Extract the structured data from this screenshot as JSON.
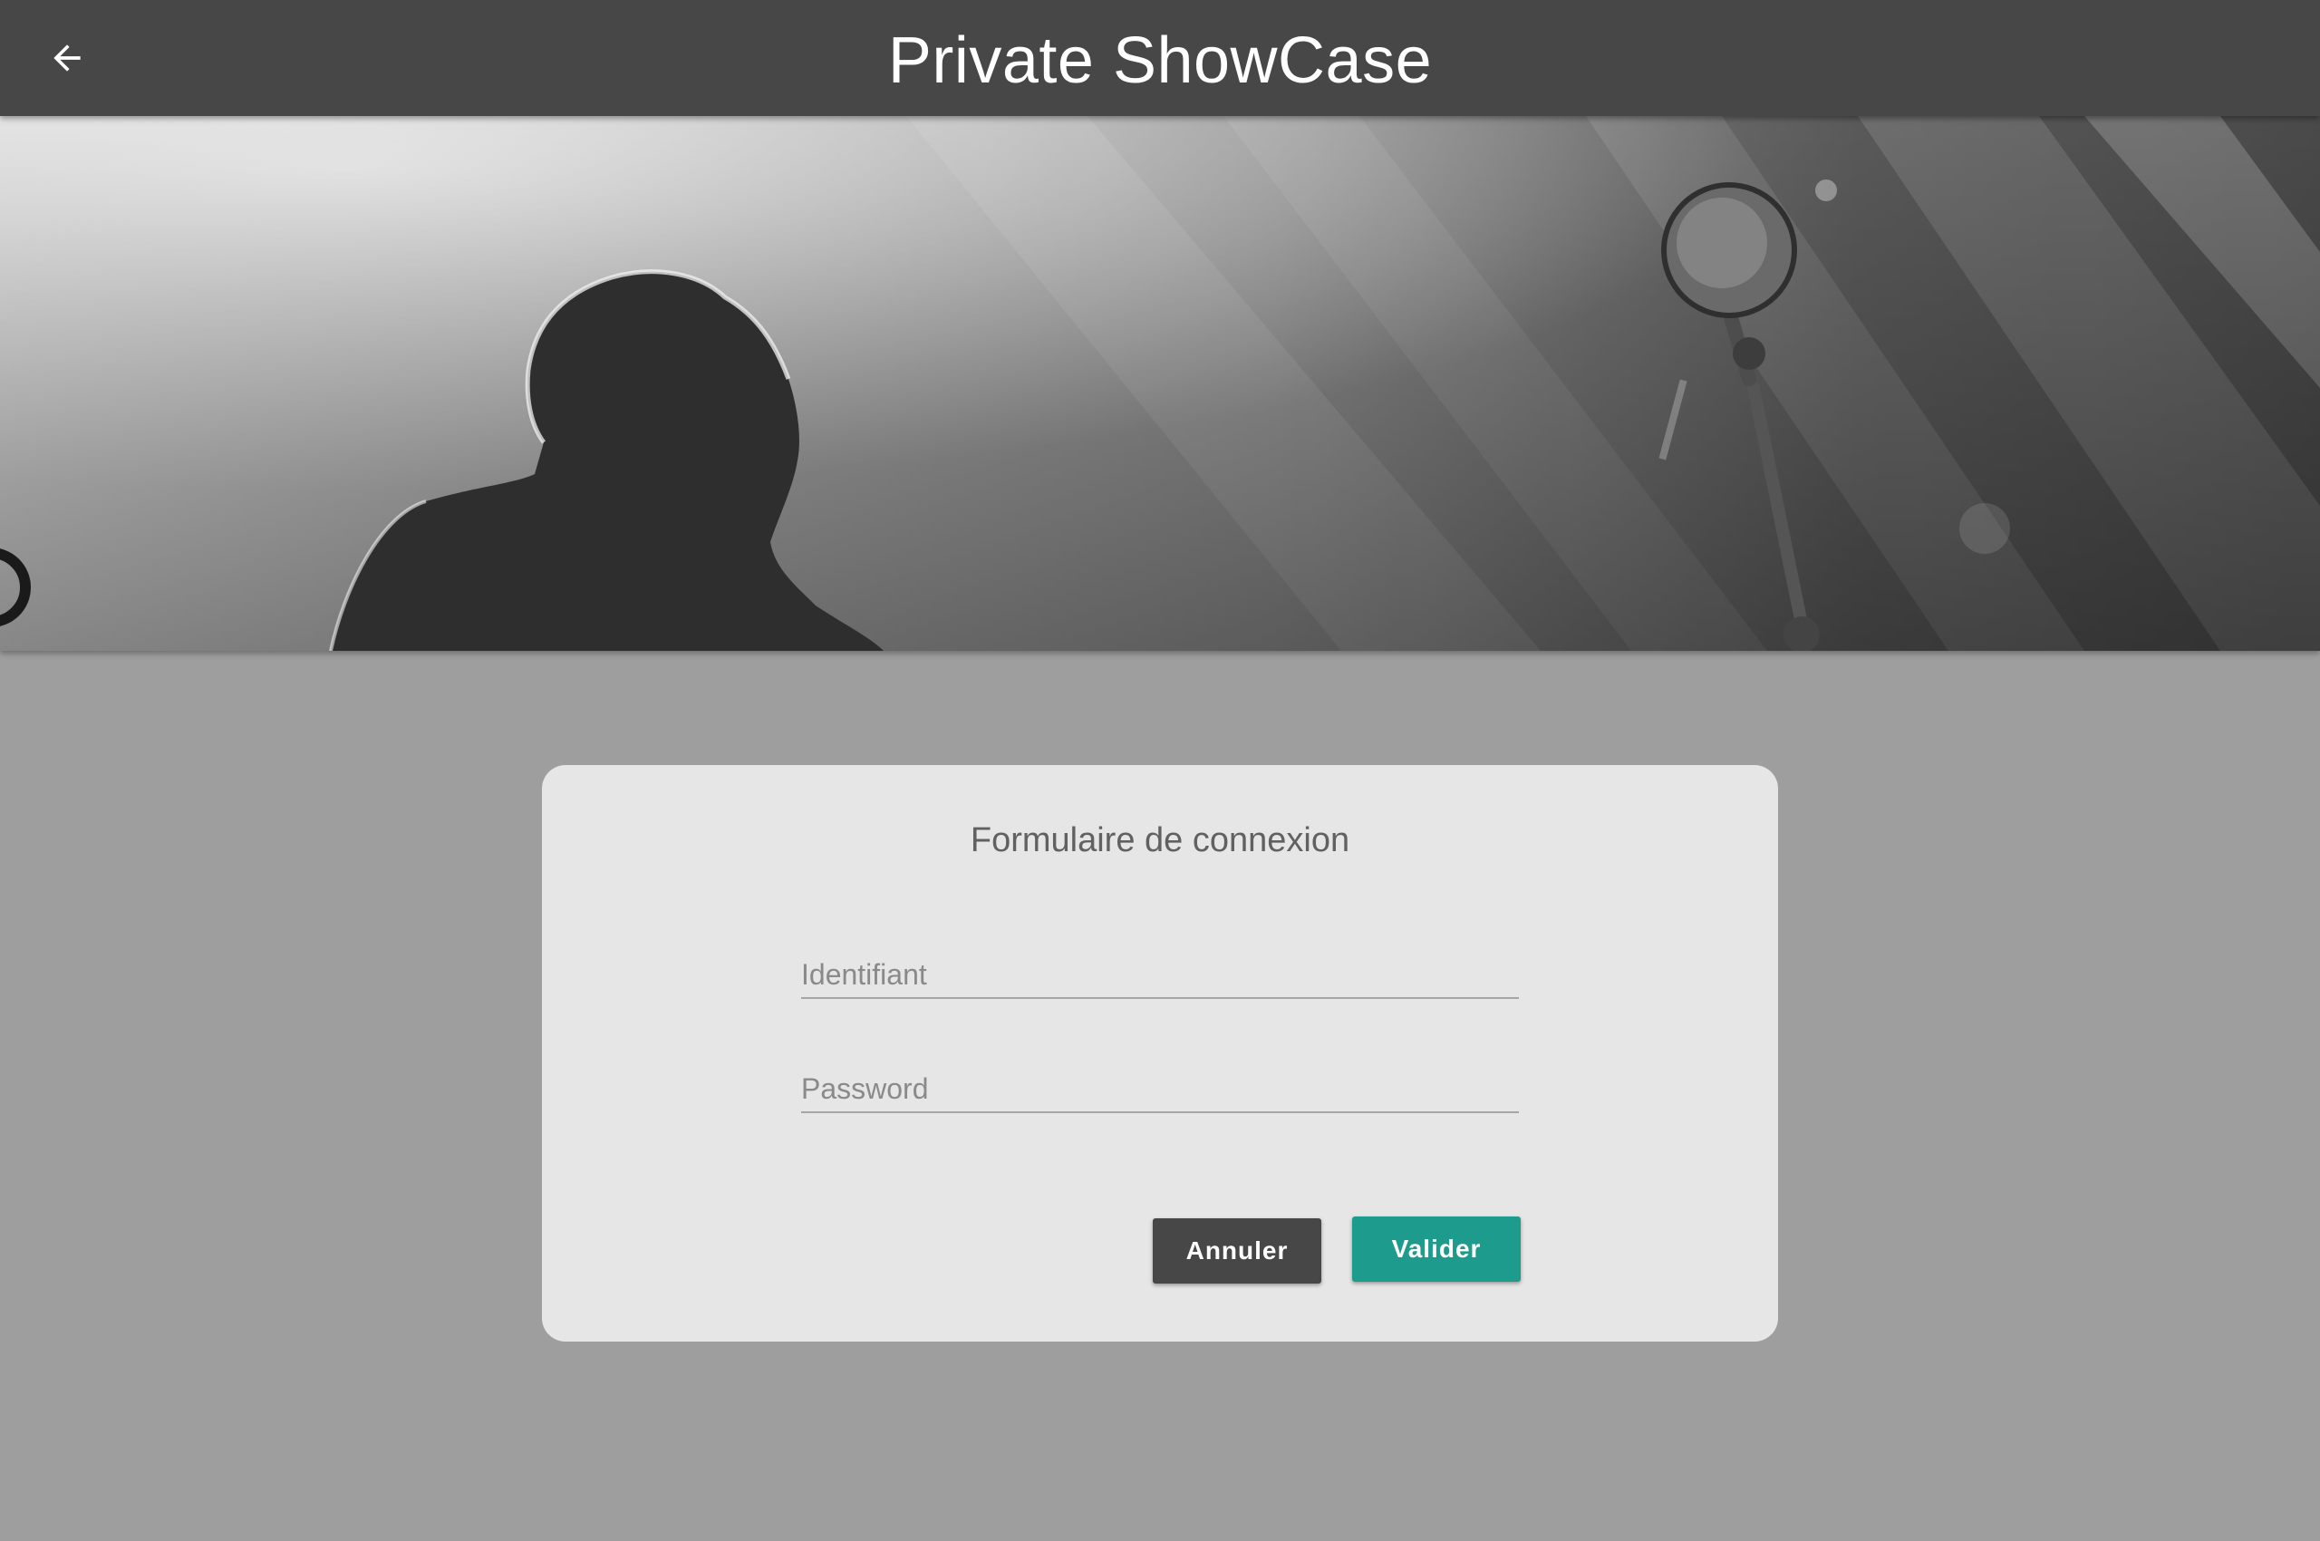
{
  "header": {
    "title": "Private ShowCase",
    "back_icon": "arrow-left-icon"
  },
  "hero": {
    "icon": "concert-photo"
  },
  "login": {
    "title": "Formulaire de connexion",
    "username_placeholder": "Identifiant",
    "username_value": "",
    "password_placeholder": "Password",
    "password_value": "",
    "cancel_label": "Annuler",
    "submit_label": "Valider"
  },
  "colors": {
    "appbar": "#474747",
    "background": "#9e9e9e",
    "card": "#e6e6e6",
    "cancel_button": "#474747",
    "submit_button": "#1d9c8d"
  }
}
